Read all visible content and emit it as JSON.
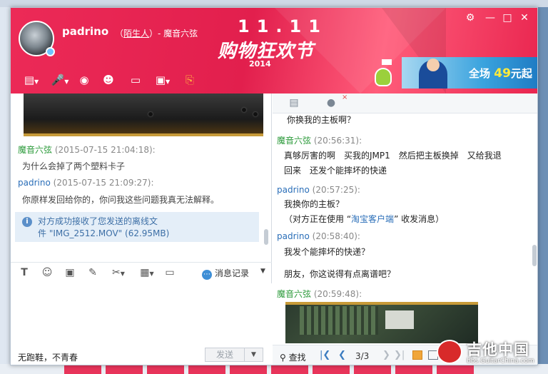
{
  "contact": {
    "name": "padrino",
    "relation_open": "（",
    "relation": "陌生人",
    "relation_close": "）- 魔音六弦"
  },
  "banner": {
    "eleven": "11.11",
    "text": "购物狂欢节",
    "year": "2014"
  },
  "ad": {
    "prefix": "全场",
    "number": "49",
    "suffix": "元起"
  },
  "window_controls": {
    "settings_icon": "gear-icon",
    "minimize_icon": "minimize-icon",
    "maximize_icon": "maximize-icon",
    "close_icon": "close-icon"
  },
  "toolbar_icons": [
    "folder-send-icon",
    "voice-call-icon",
    "video-call-icon",
    "add-contact-icon",
    "screen-share-icon",
    "remote-assist-icon",
    "file-transfer-icon"
  ],
  "left_chat": {
    "messages": [
      {
        "sender": "魔音六弦",
        "time": "(2015-07-15 21:04:18):",
        "text": "为什么会掉了两个塑料卡子"
      },
      {
        "sender": "padrino",
        "time": "(2015-07-15 21:09:27):",
        "text": "你原样发回给你的，你问我这些问题我真无法解释。"
      }
    ],
    "notice_line1": "对方成功接收了您发送的离线文",
    "notice_line2": "件 \"IMG_2512.MOV\" (62.95MB)"
  },
  "input_toolbar": {
    "icons": [
      "font-icon",
      "emoji-icon",
      "image-icon",
      "edit-icon",
      "scissors-icon",
      "table-icon",
      "screenshot-icon"
    ],
    "history_label": "消息记录"
  },
  "compose": {
    "signature": "无跑鞋，不青春",
    "send_label": "发送"
  },
  "right_chat": {
    "tabs": [
      "contact-card-icon",
      "chat-bubble-icon"
    ],
    "tab_close": "×",
    "top_line": "你换我的主板啊？",
    "messages": [
      {
        "sender": "魔音六弦",
        "time": "(20:56:31):",
        "lines": [
          "真够厉害的啊　买我的JMP1　然后把主板换掉　又给我退",
          "回来　还发个能摔坏的快递"
        ]
      },
      {
        "sender": "padrino",
        "time": "(20:57:25):",
        "lines": [
          "我换你的主板？"
        ],
        "note_prefix": "（对方正在使用 “",
        "note_link": "淘宝客户端",
        "note_suffix": "” 收发消息）"
      },
      {
        "sender": "padrino",
        "time": "(20:58:40):",
        "lines": [
          "我发个能摔坏的快递？",
          "朋友，你这说得有点离谱吧？"
        ]
      },
      {
        "sender": "魔音六弦",
        "time": "(20:59:48):",
        "lines": []
      }
    ]
  },
  "right_bottom": {
    "find_label": "查找",
    "page": "3/3"
  },
  "watermark": {
    "text": "吉他中国",
    "url": "bbs.GuitarChina.com"
  },
  "colors": {
    "header_red": "#e21f4d",
    "green_name": "#2b9a3a",
    "blue_name": "#2a6eb8",
    "notice_bg": "#e4eef8"
  }
}
